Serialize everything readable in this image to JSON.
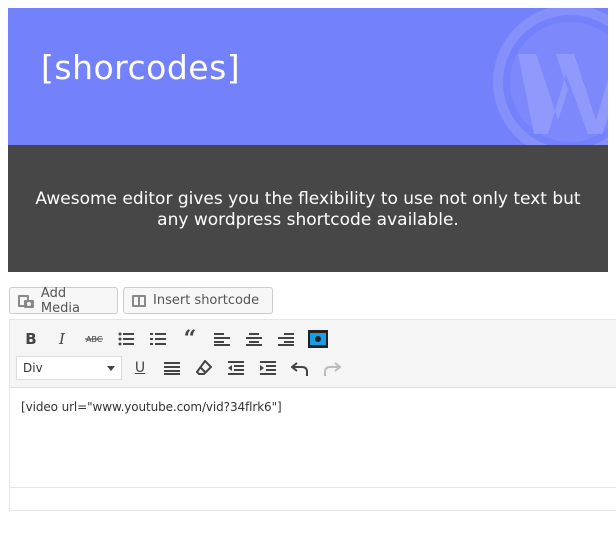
{
  "hero": {
    "title": "[shorcodes]"
  },
  "banner": {
    "text": "Awesome editor gives you the flexibility to use not only text but any wordpress shortcode available."
  },
  "media_buttons": {
    "add_media": "Add Media",
    "insert_shortcode": "Insert shortcode"
  },
  "toolbar": {
    "format_select": {
      "selected": "Div"
    },
    "row1": [
      "bold-icon",
      "italic-icon",
      "strikethrough-icon",
      "bullet-list-icon",
      "numbered-list-icon",
      "blockquote-icon",
      "align-left-icon",
      "align-center-icon",
      "align-right-icon",
      "shortcode-icon"
    ],
    "row2": [
      "underline-icon",
      "justify-icon",
      "clear-formatting-icon",
      "outdent-icon",
      "indent-icon",
      "undo-icon",
      "redo-icon"
    ]
  },
  "editor": {
    "content": "[video url=\"www.youtube.com/vid?34flrk6\"]"
  },
  "colors": {
    "hero_bg": "#7381fb",
    "band_bg": "#474747",
    "toolbar_bg": "#f5f5f5",
    "shortcode_icon_bg": "#1a9ee6"
  }
}
